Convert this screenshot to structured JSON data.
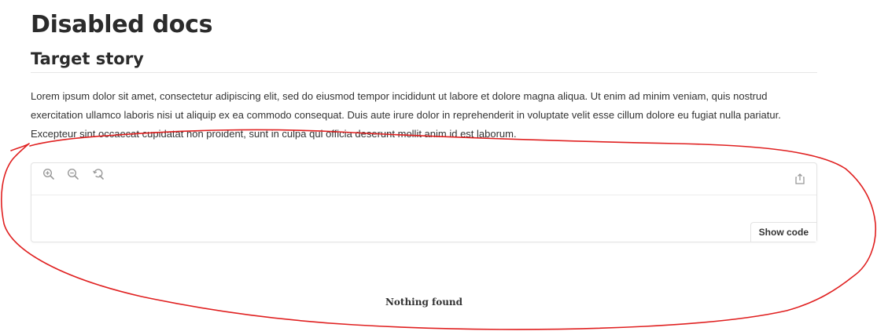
{
  "doc": {
    "title": "Disabled docs",
    "story_title": "Target story",
    "description": "Lorem ipsum dolor sit amet, consectetur adipiscing elit, sed do eiusmod tempor incididunt ut labore et dolore magna aliqua. Ut enim ad minim veniam, quis nostrud exercitation ullamco laboris nisi ut aliquip ex ea commodo consequat. Duis aute irure dolor in reprehenderit in voluptate velit esse cillum dolore eu fugiat nulla pariatur. Excepteur sint occaecat cupidatat non proident, sunt in culpa qui officia deserunt mollit anim id est laborum."
  },
  "preview": {
    "toolbar": {
      "icons": [
        "zoom-in-icon",
        "zoom-out-icon",
        "reset-zoom-icon",
        "share-icon"
      ]
    },
    "show_code_label": "Show code"
  },
  "empty_state": {
    "message": "Nothing found"
  },
  "colors": {
    "text": "#333333",
    "border": "#e3e3e3",
    "icon": "#999999",
    "annotation": "#e02020"
  }
}
